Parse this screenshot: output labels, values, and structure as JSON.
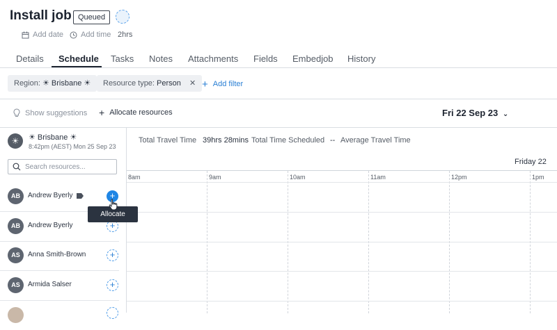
{
  "header": {
    "title": "Install job",
    "status_badge": "Queued",
    "add_date": "Add date",
    "add_time": "Add time",
    "duration": "2hrs"
  },
  "tabs": [
    {
      "label": "Details"
    },
    {
      "label": "Schedule",
      "active": true
    },
    {
      "label": "Tasks"
    },
    {
      "label": "Notes"
    },
    {
      "label": "Attachments"
    },
    {
      "label": "Fields"
    },
    {
      "label": "Embedjob"
    },
    {
      "label": "History"
    }
  ],
  "filters": {
    "region_label": "Region:",
    "region_value": "☀ Brisbane ☀",
    "resource_type_label": "Resource type:",
    "resource_type_value": "Person",
    "add_filter": "Add filter"
  },
  "toolbar": {
    "show_suggestions": "Show suggestions",
    "allocate_resources": "Allocate resources",
    "date": "Fri 22 Sep 23"
  },
  "region": {
    "name": "☀ Brisbane ☀",
    "local_time": "8:42pm (AEST) Mon 25 Sep 23"
  },
  "search": {
    "placeholder": "Search resources..."
  },
  "stats": {
    "total_travel_label": "Total Travel Time",
    "total_travel_value": "39hrs 28mins",
    "total_scheduled_label": "Total Time Scheduled",
    "total_scheduled_value": "--",
    "avg_travel_label": "Average Travel Time"
  },
  "schedule": {
    "day_label": "Friday 22",
    "hours": [
      "8am",
      "9am",
      "10am",
      "11am",
      "12pm",
      "1pm"
    ]
  },
  "resources": [
    {
      "initials": "AB",
      "name": "Andrew Byerly"
    },
    {
      "initials": "AB",
      "name": "Andrew Byerly"
    },
    {
      "initials": "AS",
      "name": "Anna Smith-Brown"
    },
    {
      "initials": "AS",
      "name": "Armida Salser"
    }
  ],
  "tooltip": {
    "text": "Allocate"
  },
  "colors": {
    "accent": "#1f86e5",
    "text_dark": "#1d2430",
    "avatar_bg": "#5e6570",
    "chip_bg": "#eef0f3"
  }
}
